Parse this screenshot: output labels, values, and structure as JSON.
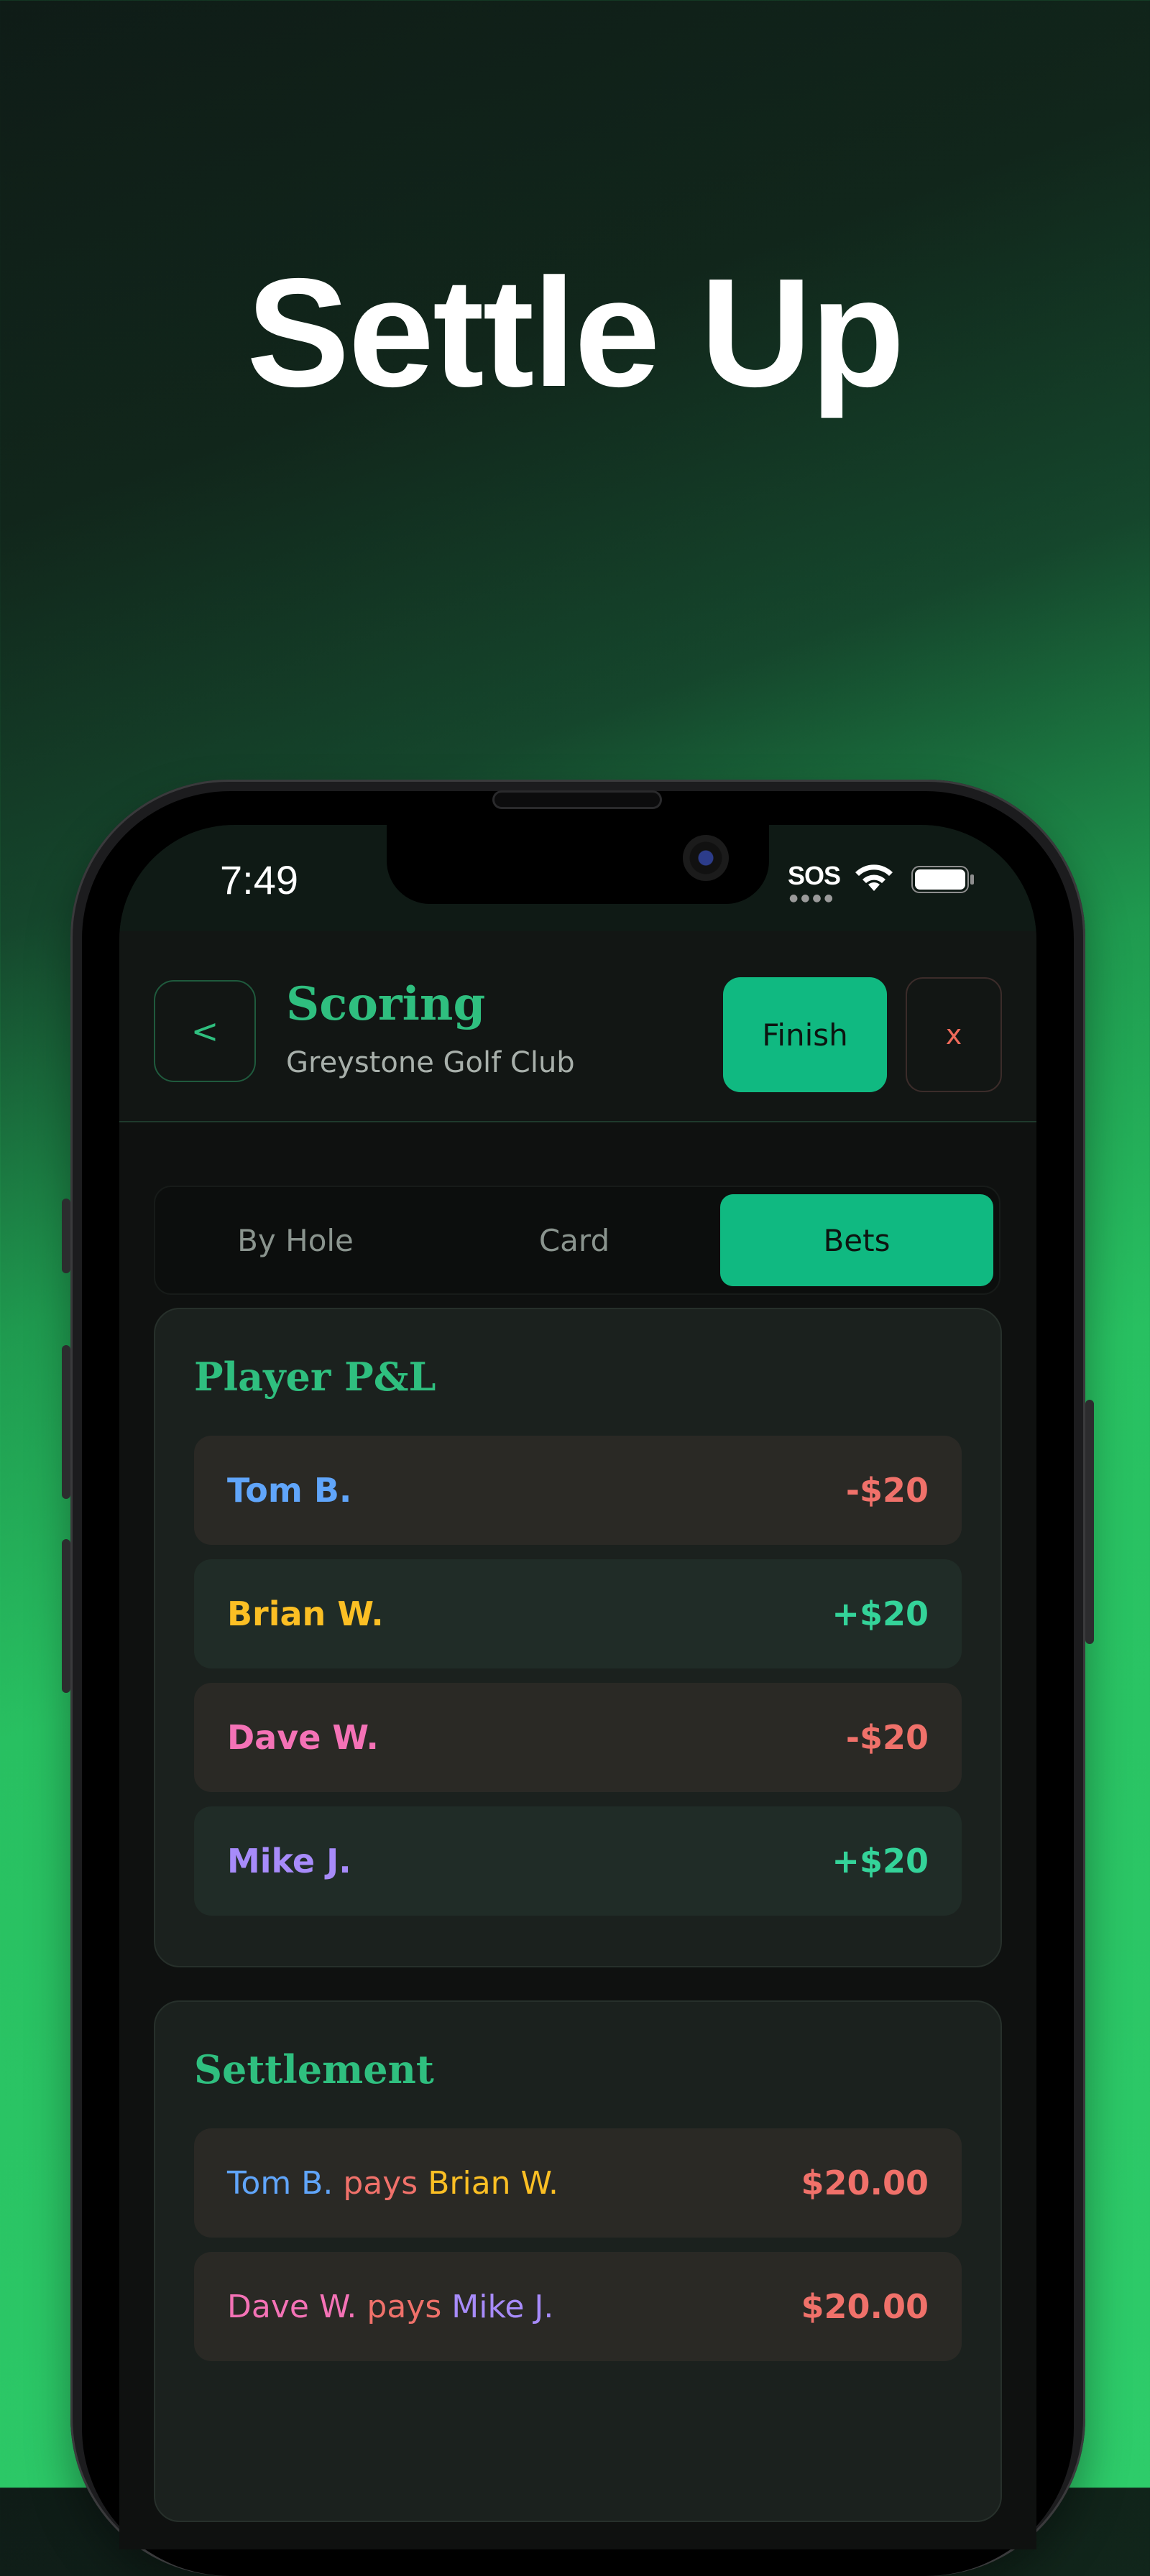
{
  "headline": "Settle Up",
  "status_bar": {
    "time": "7:49",
    "sos": "SOS"
  },
  "header": {
    "back_label": "<",
    "title": "Scoring",
    "subtitle": "Greystone Golf Club",
    "finish_label": "Finish",
    "close_label": "x"
  },
  "tabs": [
    {
      "label": "By Hole",
      "active": false
    },
    {
      "label": "Card",
      "active": false
    },
    {
      "label": "Bets",
      "active": true
    }
  ],
  "pnl": {
    "title": "Player P&L",
    "rows": [
      {
        "name": "Tom B.",
        "amount": "-$20"
      },
      {
        "name": "Brian W.",
        "amount": "+$20"
      },
      {
        "name": "Dave W.",
        "amount": "-$20"
      },
      {
        "name": "Mike J.",
        "amount": "+$20"
      }
    ]
  },
  "settlement": {
    "title": "Settlement",
    "pays_word": "pays",
    "rows": [
      {
        "payer": "Tom B.",
        "payee": "Brian W.",
        "amount": "$20.00"
      },
      {
        "payer": "Dave W.",
        "payee": "Mike J.",
        "amount": "$20.00"
      }
    ]
  },
  "colors": {
    "accent": "#10b981",
    "title_green": "#2fbf7f",
    "negative": "#f0716a",
    "positive": "#34d399",
    "player_tom": "#60a5fa",
    "player_brian": "#fbbf24",
    "player_dave": "#f472b6",
    "player_mike": "#a78bfa"
  }
}
